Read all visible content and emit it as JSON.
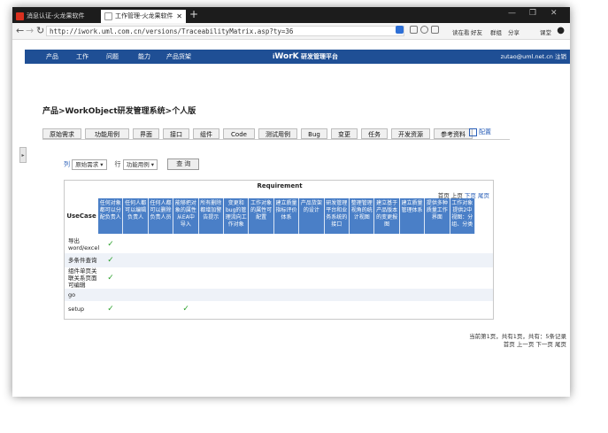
{
  "browser": {
    "tabs": [
      {
        "title": "消息认证-火龙果软件"
      },
      {
        "title": "工作管理-火龙果软件"
      }
    ],
    "url": "http://iwork.uml.com.cn/versions/TraceabilityMatrix.asp?ty=36",
    "toolbar_links": [
      "读在看",
      "好友",
      "群组",
      "分享",
      "课堂"
    ]
  },
  "app": {
    "menu": [
      "产品",
      "工作",
      "问题",
      "能力",
      "产品货架"
    ],
    "brand_prefix": "i",
    "brand_mark": "WorK",
    "brand_suffix": "研发管理平台",
    "account": "zutao@uml.net.cn 注销"
  },
  "breadcrumb": "产品>WorkObject研发管理系统>个人版",
  "object_tabs": [
    "原始需求",
    "功能用例",
    "界面",
    "接口",
    "组件",
    "Code",
    "测试用例",
    "Bug",
    "变更",
    "任务",
    "开发资源",
    "参考资料"
  ],
  "config_label": "配置",
  "filter": {
    "col_label": "列",
    "col_value": "原始需求 ▾",
    "row_label": "行",
    "row_value": "功能用例 ▾",
    "query_button": "查 询"
  },
  "matrix": {
    "title": "Requirement",
    "pager_top": {
      "first": "首页",
      "prev": "上页",
      "next": "下页",
      "last": "尾页"
    },
    "corner": "UseCase",
    "columns": [
      "任何对象都可以分配负责人",
      "任何人都可以编辑负责人",
      "任何人都可以删除负责人员",
      "能够把对象的属性从EA中导入",
      "所有删除都增加警告提示",
      "变更和bug的管理流向工作对象",
      "工作对象的属性可配置",
      "建立质量指标评价体系",
      "产品货架的设计",
      "研发管理平台和业务系统的接口",
      "整理管理视角的统计视图",
      "建立基于产品版本的变更报图",
      "建立质量管理体系",
      "提供多种质量工作界面",
      "工作对象提供2中视图：分组、分类"
    ],
    "rows": [
      {
        "label": "导出word/excel",
        "checks": [
          0
        ]
      },
      {
        "label": "多条件查询",
        "checks": [
          0
        ]
      },
      {
        "label": "组件单页关联关系页面可编辑",
        "checks": [
          0
        ]
      },
      {
        "label": "go",
        "checks": []
      },
      {
        "label": "setup",
        "checks": [
          0,
          3
        ]
      }
    ],
    "check_glyph": "✓"
  },
  "pager_bottom": {
    "line1": "当前第1页，共有1页，共有：5条记录",
    "line2": "首页 上一页 下一页 尾页"
  }
}
